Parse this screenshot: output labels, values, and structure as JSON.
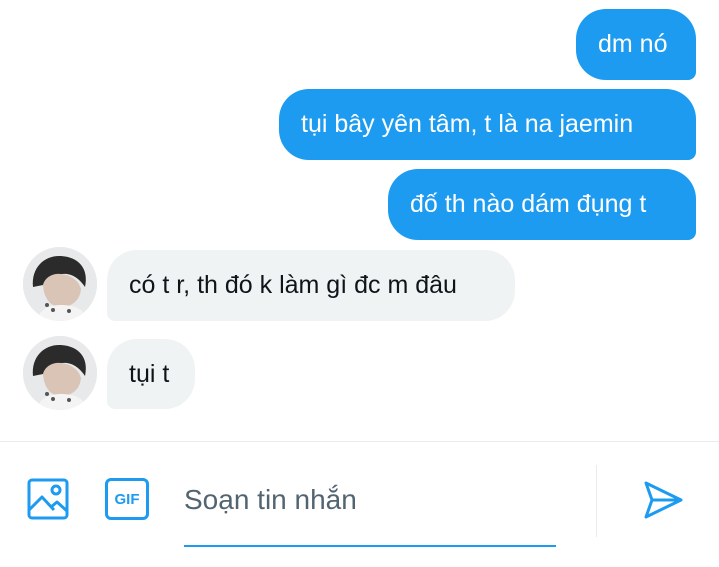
{
  "messages": [
    {
      "direction": "sent",
      "text": "dm nó"
    },
    {
      "direction": "sent",
      "text": "tụi bây yên tâm, t là na jaemin"
    },
    {
      "direction": "sent",
      "text": "đố th nào dám đụng t"
    },
    {
      "direction": "received",
      "text": "có t r, th đó k làm gì đc m đâu"
    },
    {
      "direction": "received",
      "text": "tụi t"
    }
  ],
  "composer": {
    "placeholder": "Soạn tin nhắn",
    "gif_label": "GIF",
    "icons": [
      "image-icon",
      "gif-icon",
      "send-icon"
    ]
  },
  "colors": {
    "accent": "#1d9bf0",
    "sent_bubble": "#1d9bf0",
    "received_bubble": "#eff3f4",
    "text": "#0f1419",
    "placeholder": "#536471"
  }
}
